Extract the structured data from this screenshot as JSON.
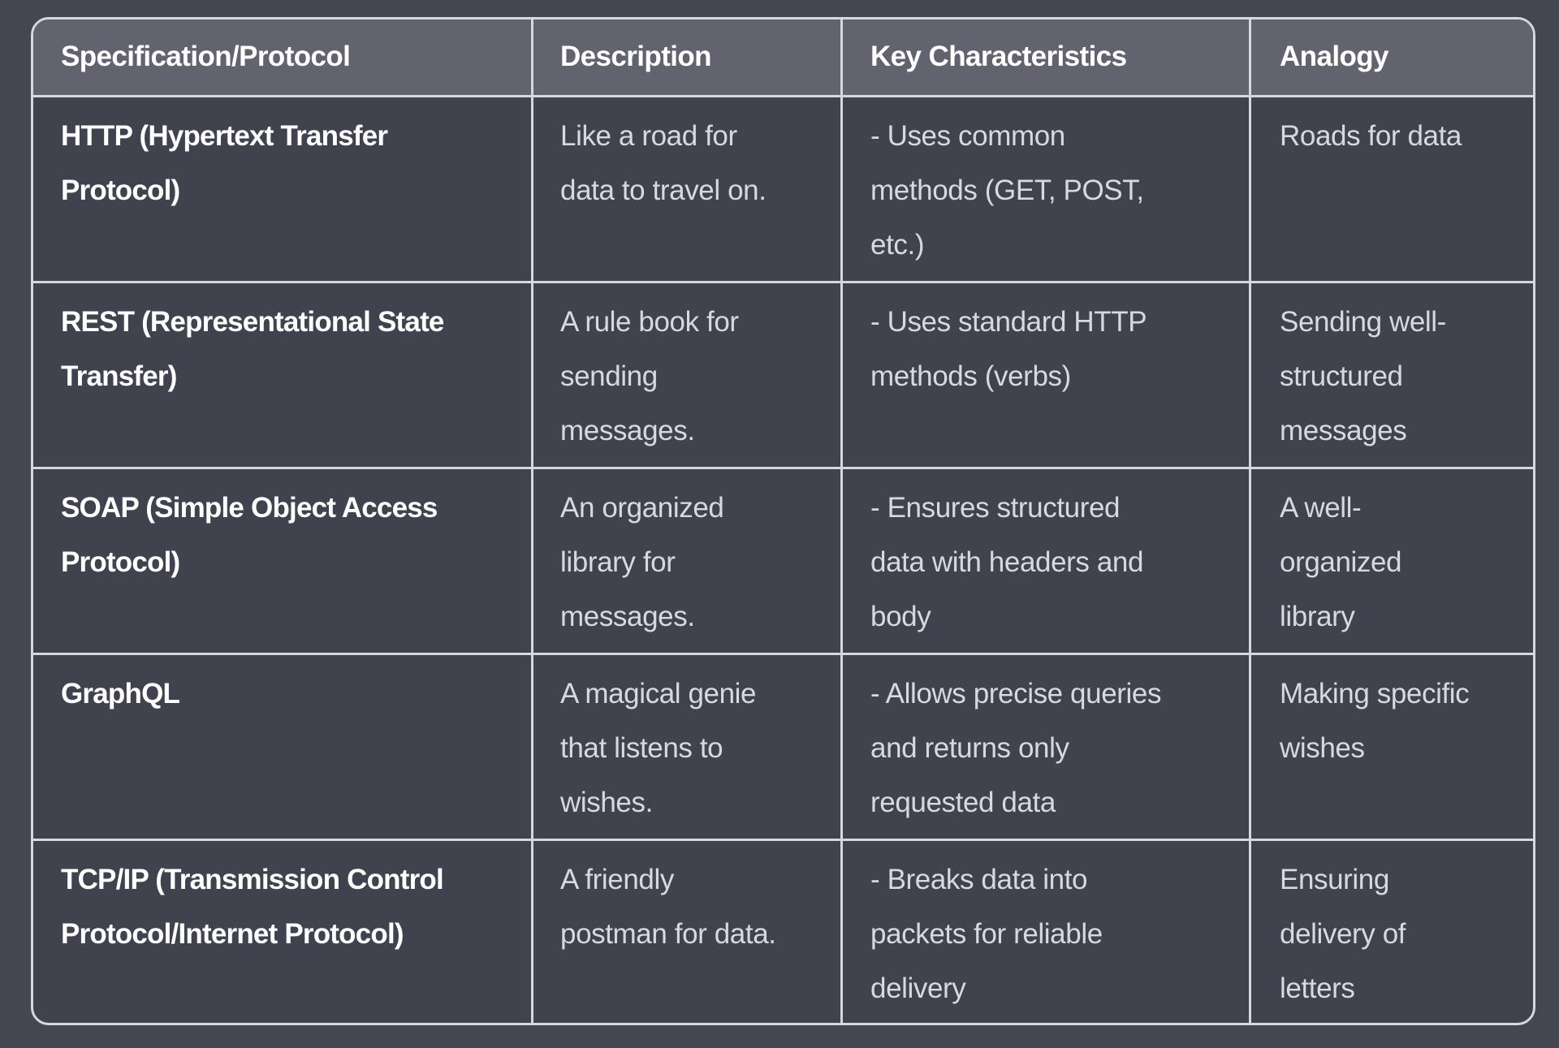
{
  "table": {
    "headers": [
      "Specification/Protocol",
      "Description",
      "Key Characteristics",
      "Analogy"
    ],
    "rows": [
      {
        "spec": [
          "HTTP (Hypertext Transfer",
          "Protocol)"
        ],
        "description": [
          "Like a road for",
          "data to travel on."
        ],
        "characteristics": [
          "- Uses common",
          "methods (GET, POST,",
          "etc.)"
        ],
        "analogy": [
          "Roads for data"
        ]
      },
      {
        "spec": [
          "REST (Representational State",
          "Transfer)"
        ],
        "description": [
          "A rule book for",
          "sending",
          "messages."
        ],
        "characteristics": [
          "- Uses standard HTTP",
          "methods (verbs)"
        ],
        "analogy": [
          "Sending well-",
          "structured",
          "messages"
        ]
      },
      {
        "spec": [
          "SOAP (Simple Object Access",
          "Protocol)"
        ],
        "description": [
          "An organized",
          "library for",
          "messages."
        ],
        "characteristics": [
          "- Ensures structured",
          "data with headers and",
          "body"
        ],
        "analogy": [
          "A well-",
          "organized",
          "library"
        ]
      },
      {
        "spec": [
          "GraphQL"
        ],
        "description": [
          "A magical genie",
          "that listens to",
          "wishes."
        ],
        "characteristics": [
          "- Allows precise queries",
          "and returns only",
          "requested data"
        ],
        "analogy": [
          "Making specific",
          "wishes"
        ]
      },
      {
        "spec": [
          "TCP/IP (Transmission Control",
          "Protocol/Internet Protocol)"
        ],
        "description": [
          "A friendly",
          "postman for data."
        ],
        "characteristics": [
          "- Breaks data into",
          "packets for reliable",
          "delivery"
        ],
        "analogy": [
          "Ensuring",
          "delivery of",
          "letters"
        ]
      }
    ]
  },
  "colors": {
    "page_background": "#444650",
    "header_background": "#62636f",
    "cell_background": "#40424d",
    "border": "#d6d8df",
    "header_text": "#ffffff",
    "body_text": "#d8d9e0"
  }
}
